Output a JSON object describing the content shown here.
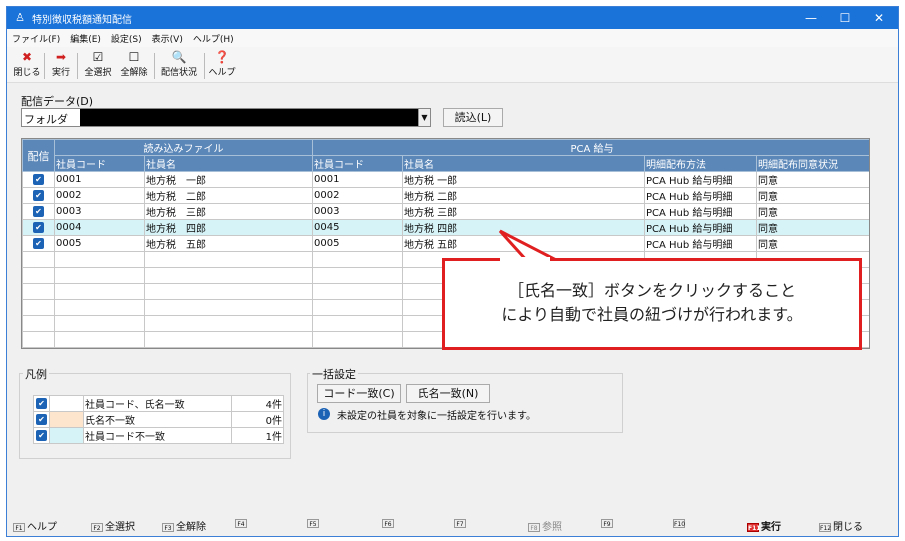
{
  "window": {
    "title": "特別徴収税額通知配信",
    "min": "—",
    "max": "☐",
    "close": "✕"
  },
  "menu": [
    "ファイル(F)",
    "編集(E)",
    "設定(S)",
    "表示(V)",
    "ヘルプ(H)"
  ],
  "toolbar": [
    {
      "icon": "✖",
      "label": "閉じる",
      "color": "#d12020"
    },
    {
      "icon": "➡",
      "label": "実行",
      "color": "#d12020"
    },
    {
      "icon": "☑",
      "label": "全選択",
      "color": "#333"
    },
    {
      "icon": "☐",
      "label": "全解除",
      "color": "#333"
    },
    {
      "icon": "🔍",
      "label": "配信状況",
      "color": "#333"
    },
    {
      "icon": "❓",
      "label": "ヘルプ",
      "color": "#2060c0"
    }
  ],
  "data_section": {
    "label": "配信データ(D)",
    "folder_label": "フォルダ",
    "read_button": "読込(L)"
  },
  "grid": {
    "col_haishin": "配信",
    "group_read": "読み込みファイル",
    "group_pca": "PCA 給与",
    "headers": [
      "社員コード",
      "社員名",
      "社員コード",
      "社員名",
      "明細配布方法",
      "明細配布同意状況"
    ],
    "rows": [
      [
        "0001",
        "地方税　一郎",
        "0001",
        "地方税 一郎",
        "PCA Hub 給与明細",
        "同意"
      ],
      [
        "0002",
        "地方税　二郎",
        "0002",
        "地方税 二郎",
        "PCA Hub 給与明細",
        "同意"
      ],
      [
        "0003",
        "地方税　三郎",
        "0003",
        "地方税 三郎",
        "PCA Hub 給与明細",
        "同意"
      ],
      [
        "0004",
        "地方税　四郎",
        "0045",
        "地方税 四郎",
        "PCA Hub 給与明細",
        "同意"
      ],
      [
        "0005",
        "地方税　五郎",
        "0005",
        "地方税 五郎",
        "PCA Hub 給与明細",
        "同意"
      ]
    ],
    "empty_rows": 6
  },
  "legend": {
    "title": "凡例",
    "rows": [
      {
        "label": "社員コード、氏名一致",
        "count": "4件",
        "color": "#ffffff"
      },
      {
        "label": "氏名不一致",
        "count": "0件",
        "color": "#fde4cc"
      },
      {
        "label": "社員コード不一致",
        "count": "1件",
        "color": "#d6f3f8"
      }
    ]
  },
  "bulk": {
    "title": "一括設定",
    "code_button": "コード一致(C)",
    "name_button": "氏名一致(N)",
    "info": "未設定の社員を対象に一括設定を行います。"
  },
  "fkeys": [
    "ヘルプ",
    "全選択",
    "全解除",
    "",
    "",
    "",
    "",
    "参照",
    "",
    "",
    "実行",
    "閉じる"
  ],
  "callout": {
    "line1": "［氏名一致］ボタンをクリックすること",
    "line2": "により自動で社員の紐づけが行われます。"
  }
}
